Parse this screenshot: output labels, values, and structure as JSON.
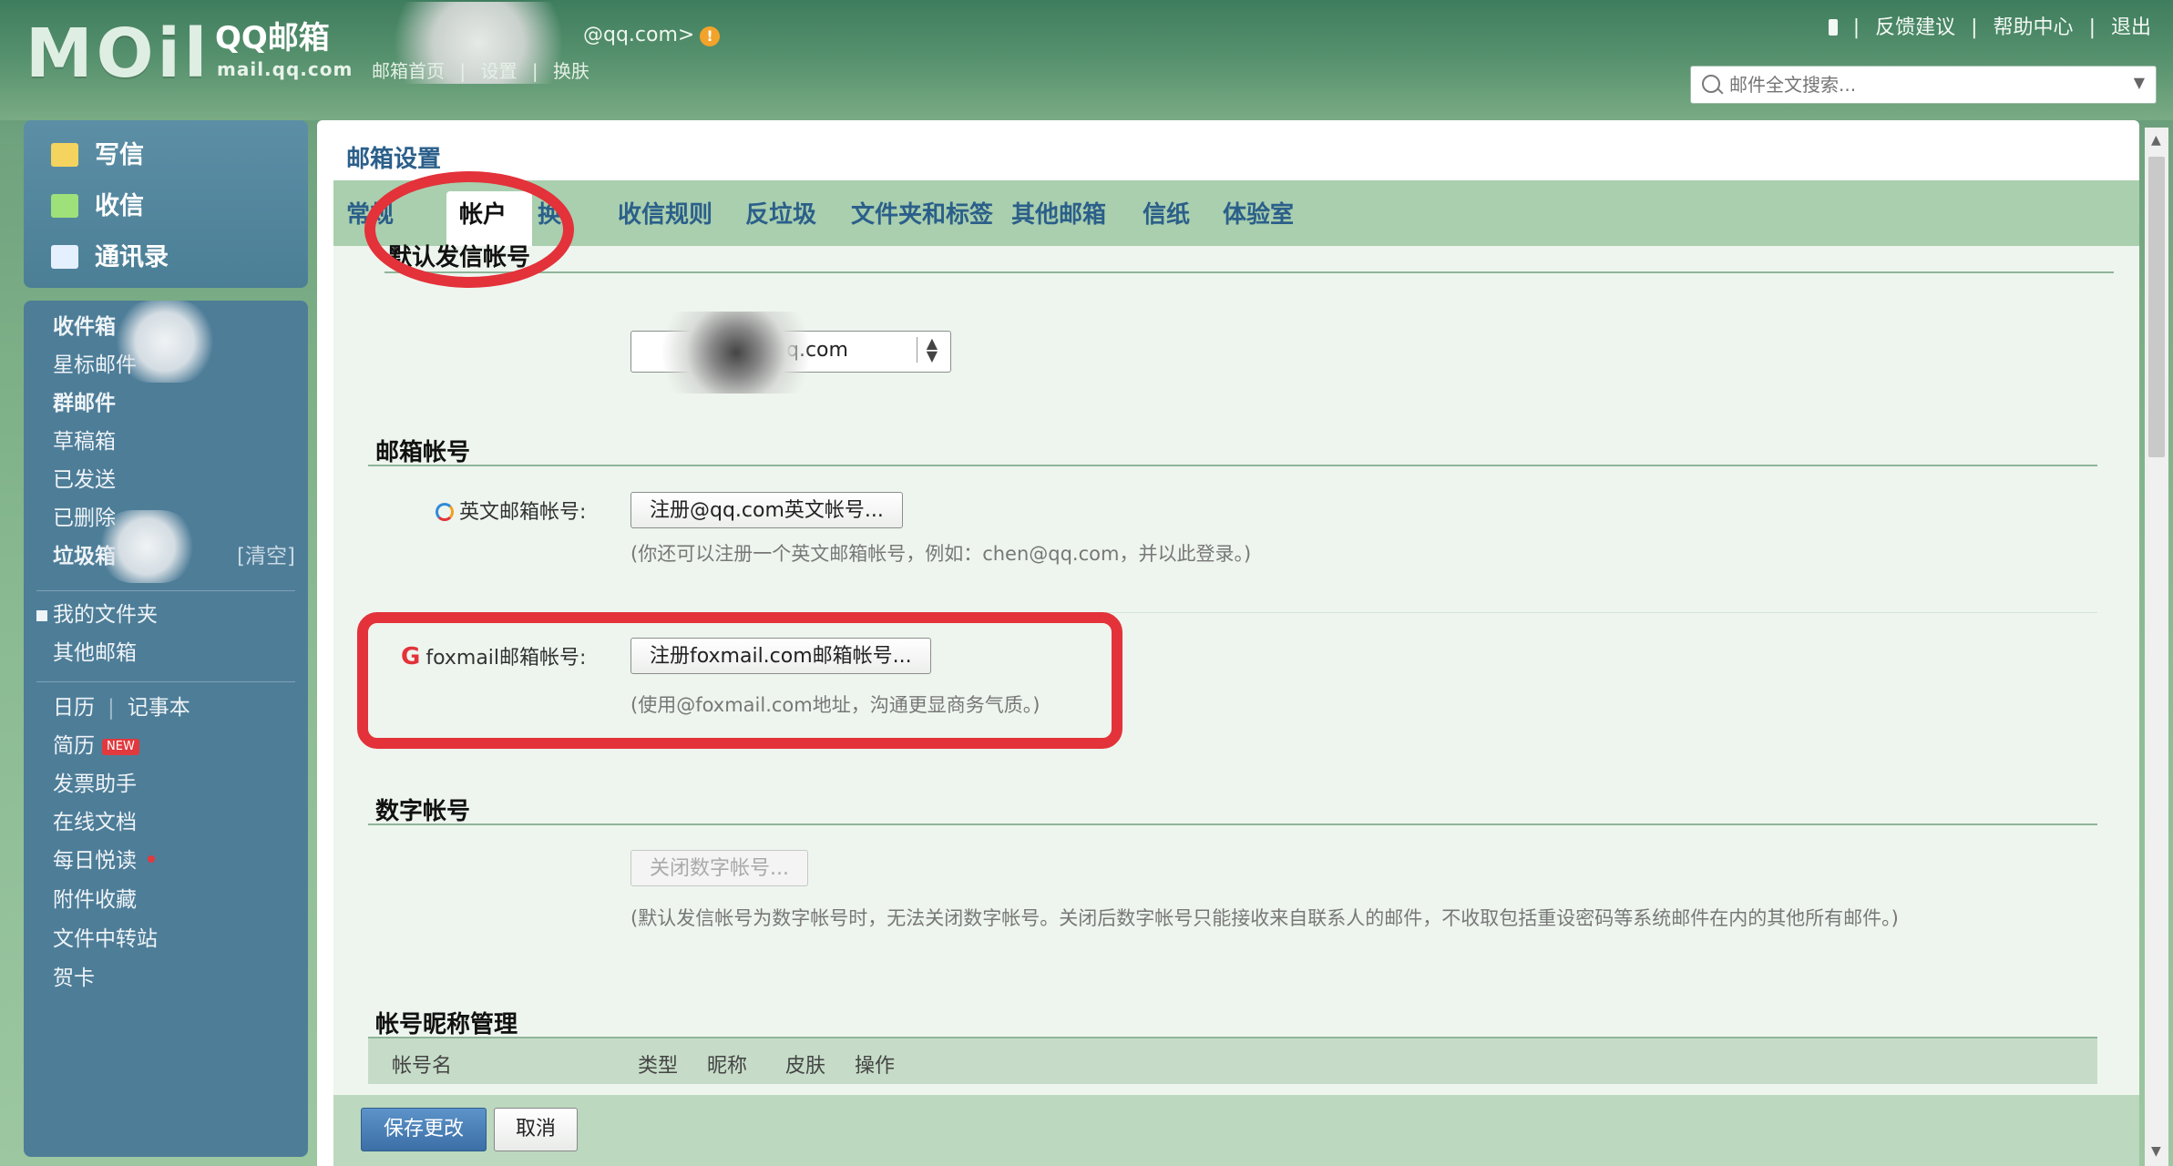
{
  "header": {
    "logo_main": "MOil",
    "logo_cn": "QQ邮箱",
    "logo_domain": "mail.qq.com",
    "account_email": "@qq.com>",
    "nav": [
      "邮箱首页",
      "|",
      "设置",
      "|",
      "换肤"
    ],
    "top_links": [
      "|",
      "反馈建议",
      "|",
      "帮助中心",
      "|",
      "退出"
    ],
    "search_placeholder": "邮件全文搜索..."
  },
  "compose": {
    "items": [
      "写信",
      "收信",
      "通讯录"
    ],
    "icon_colors": [
      "#f4d35e",
      "#9ee07a",
      "#e5f0ff"
    ]
  },
  "folders": {
    "inbox": "收件箱",
    "starred": "星标邮件",
    "group": "群邮件",
    "drafts": "草稿箱",
    "sent": "已发送",
    "deleted": "已删除",
    "spam": "垃圾箱",
    "spam_clear": "[清空]",
    "my_folders": "我的文件夹",
    "other_mailbox": "其他邮箱",
    "calendar": "日历",
    "notepad": "记事本",
    "resume": "简历",
    "new_badge": "NEW",
    "invoice": "发票助手",
    "docs": "在线文档",
    "daily": "每日悦读",
    "attachments": "附件收藏",
    "transfer": "文件中转站",
    "cards": "贺卡"
  },
  "main": {
    "title": "邮箱设置",
    "tabs": [
      "常规",
      "帐户",
      "换肤",
      "收信规则",
      "反垃圾",
      "文件夹和标签",
      "其他邮箱",
      "信纸",
      "体验室"
    ],
    "sections": {
      "default_sender": "默认发信帐号",
      "default_sender_value": "q.com",
      "mailbox_accounts": "邮箱帐号",
      "english_label": "英文邮箱帐号:",
      "english_button": "注册@qq.com英文帐号...",
      "english_hint": "(你还可以注册一个英文邮箱帐号，例如：chen@qq.com，并以此登录。)",
      "foxmail_label": "foxmail邮箱帐号:",
      "foxmail_button": "注册foxmail.com邮箱帐号...",
      "foxmail_hint": "(使用@foxmail.com地址，沟通更显商务气质。)",
      "digital_account": "数字帐号",
      "digital_button": "关闭数字帐号...",
      "digital_hint": "(默认发信帐号为数字帐号时，无法关闭数字帐号。关闭后数字帐号只能接收来自联系人的邮件，不收取包括重设密码等系统邮件在内的其他所有邮件。)",
      "nickname_mgmt": "帐号昵称管理",
      "table_headers": [
        "帐号名",
        "类型",
        "昵称",
        "皮肤",
        "操作"
      ]
    },
    "save": "保存更改",
    "cancel": "取消"
  },
  "colors": {
    "accent_blue": "#2b5f8a",
    "annotation_red": "#e3323a"
  }
}
